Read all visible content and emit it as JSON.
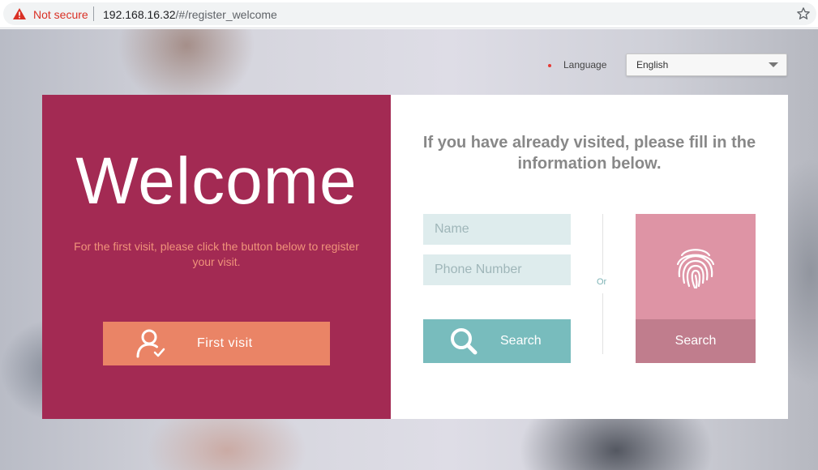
{
  "browser": {
    "security_label": "Not secure",
    "url_host": "192.168.16.32",
    "url_path": "/#/register_welcome"
  },
  "language": {
    "label": "Language",
    "selected": "English"
  },
  "welcome_panel": {
    "title": "Welcome",
    "description": "For the first visit, please click the button below to register your visit.",
    "first_visit_label": "First visit"
  },
  "returning_panel": {
    "title": "If you have already visited, please fill in the information below.",
    "name_placeholder": "Name",
    "phone_placeholder": "Phone Number",
    "or_label": "Or",
    "search_label": "Search",
    "fingerprint_search_label": "Search"
  },
  "colors": {
    "welcome_bg": "#a32a53",
    "first_visit_button": "#ea8466",
    "search_button": "#78bcbd",
    "fingerprint_box": "#de94a5",
    "fingerprint_search": "#c07d8d",
    "not_secure": "#d93025"
  },
  "icons": {
    "security": "warning-triangle-icon",
    "bookmark": "star-icon",
    "first_visit": "user-check-icon",
    "search": "magnifier-icon",
    "fingerprint": "fingerprint-icon",
    "dropdown": "caret-down-icon"
  }
}
